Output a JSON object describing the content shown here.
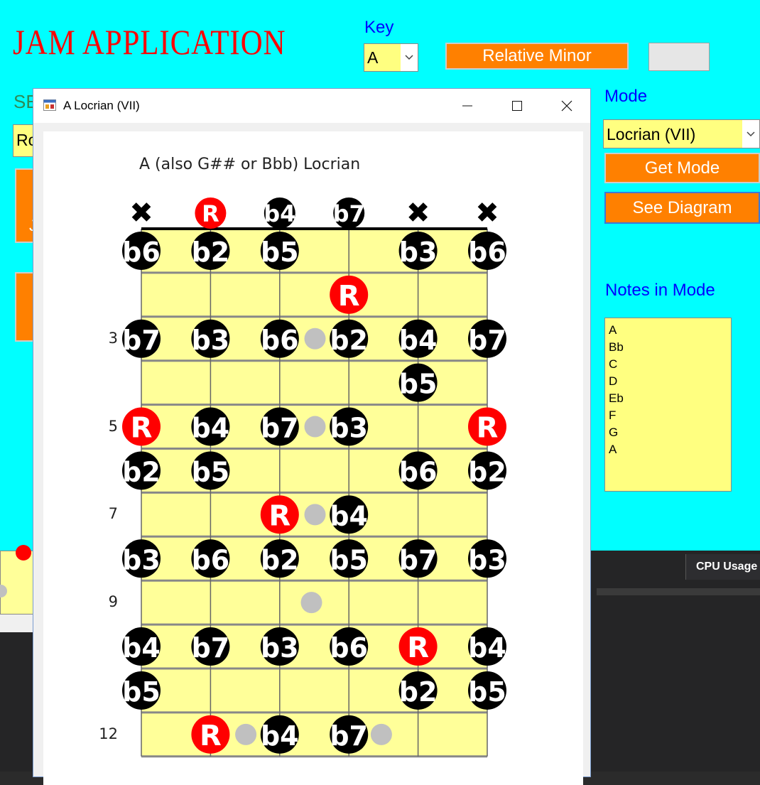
{
  "app": {
    "title": "JAM APPLICATION",
    "key_label": "Key",
    "key_value": "A",
    "relative_minor_label": "Relative Minor",
    "mode_label": "Mode",
    "mode_value": "Locrian (VII)",
    "get_mode_label": "Get Mode",
    "see_diagram_label": "See Diagram",
    "notes_label": "Notes in Mode",
    "notes": [
      "A",
      "Bb",
      "C",
      "D",
      "Eb",
      "F",
      "G",
      "A"
    ],
    "partial_select_label": "SE",
    "partial_select_value": "Ro",
    "partial_left_button": "J"
  },
  "taskbar": {
    "cpu_label": "CPU Usage"
  },
  "window": {
    "title": "A Locrian (VII)",
    "diagram_title": "A (also G## or Bbb) Locrian",
    "open_strings": [
      "x",
      "R",
      "b4",
      "b7",
      "x",
      "x"
    ],
    "fret_numbers": [
      {
        "fret": 3,
        "label": "3"
      },
      {
        "fret": 5,
        "label": "5"
      },
      {
        "fret": 7,
        "label": "7"
      },
      {
        "fret": 9,
        "label": "9"
      },
      {
        "fret": 12,
        "label": "12"
      }
    ],
    "frets": [
      [
        "b6",
        "b2",
        "b5",
        "",
        "b3",
        "b6"
      ],
      [
        "",
        "",
        "",
        "R",
        "",
        ""
      ],
      [
        "b7",
        "b3",
        "b6",
        "b2",
        "b4",
        "b7"
      ],
      [
        "",
        "",
        "",
        "",
        "b5",
        ""
      ],
      [
        "R",
        "b4",
        "b7",
        "b3",
        "",
        "R"
      ],
      [
        "b2",
        "b5",
        "",
        "",
        "b6",
        "b2"
      ],
      [
        "",
        "",
        "R",
        "b4",
        "",
        ""
      ],
      [
        "b3",
        "b6",
        "b2",
        "b5",
        "b7",
        "b3"
      ],
      [
        "",
        "",
        "",
        "",
        "",
        ""
      ],
      [
        "b4",
        "b7",
        "b3",
        "b6",
        "R",
        "b4"
      ],
      [
        "b5",
        "",
        "",
        "",
        "b2",
        "b5"
      ],
      [
        "",
        "R",
        "b4",
        "b7",
        "",
        ""
      ]
    ],
    "colors": {
      "root": "#ff0000",
      "note": "#000000",
      "fretboard": "#ffff99",
      "inlay": "#c0c0c0"
    }
  }
}
